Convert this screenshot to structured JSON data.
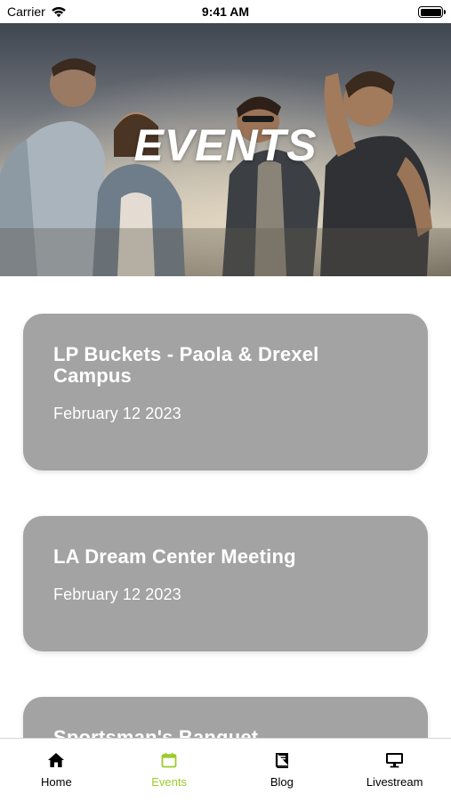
{
  "status_bar": {
    "carrier": "Carrier",
    "time": "9:41 AM"
  },
  "hero": {
    "title": "EVENTS"
  },
  "events": [
    {
      "title": "LP Buckets - Paola & Drexel Campus",
      "date": "February 12 2023"
    },
    {
      "title": "LA Dream Center Meeting",
      "date": "February 12 2023"
    },
    {
      "title": "Sportsman's Banquet",
      "date": ""
    }
  ],
  "tab_bar": {
    "active_color": "#9ccc2a",
    "tabs": [
      {
        "label": "Home",
        "icon": "home-icon"
      },
      {
        "label": "Events",
        "icon": "calendar-icon"
      },
      {
        "label": "Blog",
        "icon": "book-icon"
      },
      {
        "label": "Livestream",
        "icon": "monitor-icon"
      }
    ]
  }
}
